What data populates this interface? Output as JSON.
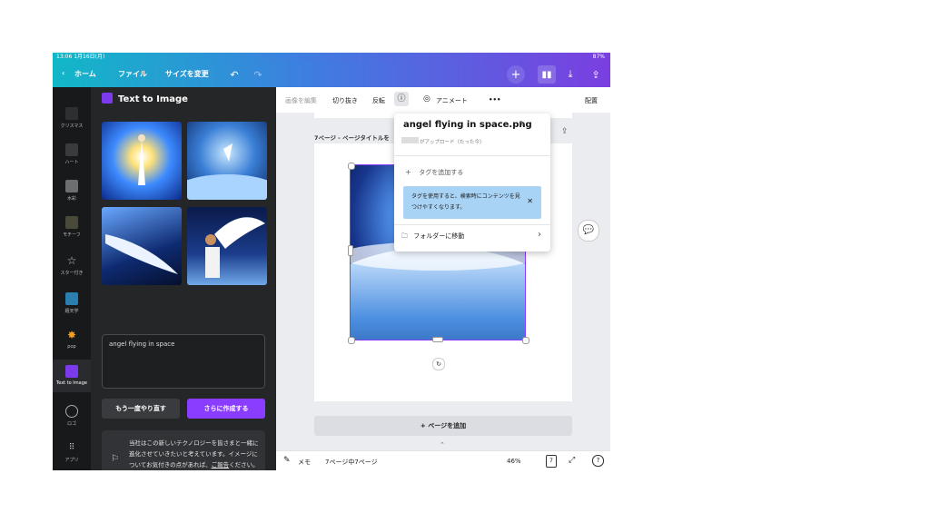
{
  "status_bar": {
    "time_date": "13:06  1月16日(月)",
    "battery": "87%"
  },
  "topbar": {
    "home": "ホーム",
    "file": "ファイル",
    "resize": "サイズを変更"
  },
  "rail": {
    "items": [
      {
        "label": "クリスマス"
      },
      {
        "label": "ハート"
      },
      {
        "label": "水彩"
      },
      {
        "label": "モチーフ"
      },
      {
        "label": "スター付き"
      },
      {
        "label": "嬉天学"
      },
      {
        "label": "pop"
      },
      {
        "label": "Text to Image"
      },
      {
        "label": "ロゴ"
      },
      {
        "label": "アプリ"
      }
    ]
  },
  "panel": {
    "title": "Text to Image",
    "prompt": "angel flying in space",
    "retry_label": "もう一度やり直す",
    "create_label": "さらに作成する",
    "notice_text": "当社はこの新しいテクノロジーを皆さまと一緒に進化させていきたいと考えています。イメージについてお気付きの点があれば、",
    "notice_link": "ご報告",
    "notice_tail": "ください。"
  },
  "toolbar": {
    "edit_image": "画像を編集",
    "crop": "切り抜き",
    "flip": "反転",
    "animate": "アニメート",
    "more": "•••",
    "position": "配置"
  },
  "workspace": {
    "page_label": "7ページ - ページタイトルを",
    "add_page": "+ ページを追加"
  },
  "popup": {
    "filename": "angel flying in space.png",
    "uploaded": "がアップロード（たった今）",
    "add_tag": "タグを追加する",
    "tip": "タグを使用すると、検索時にコンテンツを見つけやすくなります。",
    "move_folder": "フォルダーに移動"
  },
  "bottombar": {
    "memo": "メモ",
    "page_count": "7ページ中7ページ",
    "zoom": "46%",
    "page_num": "7"
  }
}
